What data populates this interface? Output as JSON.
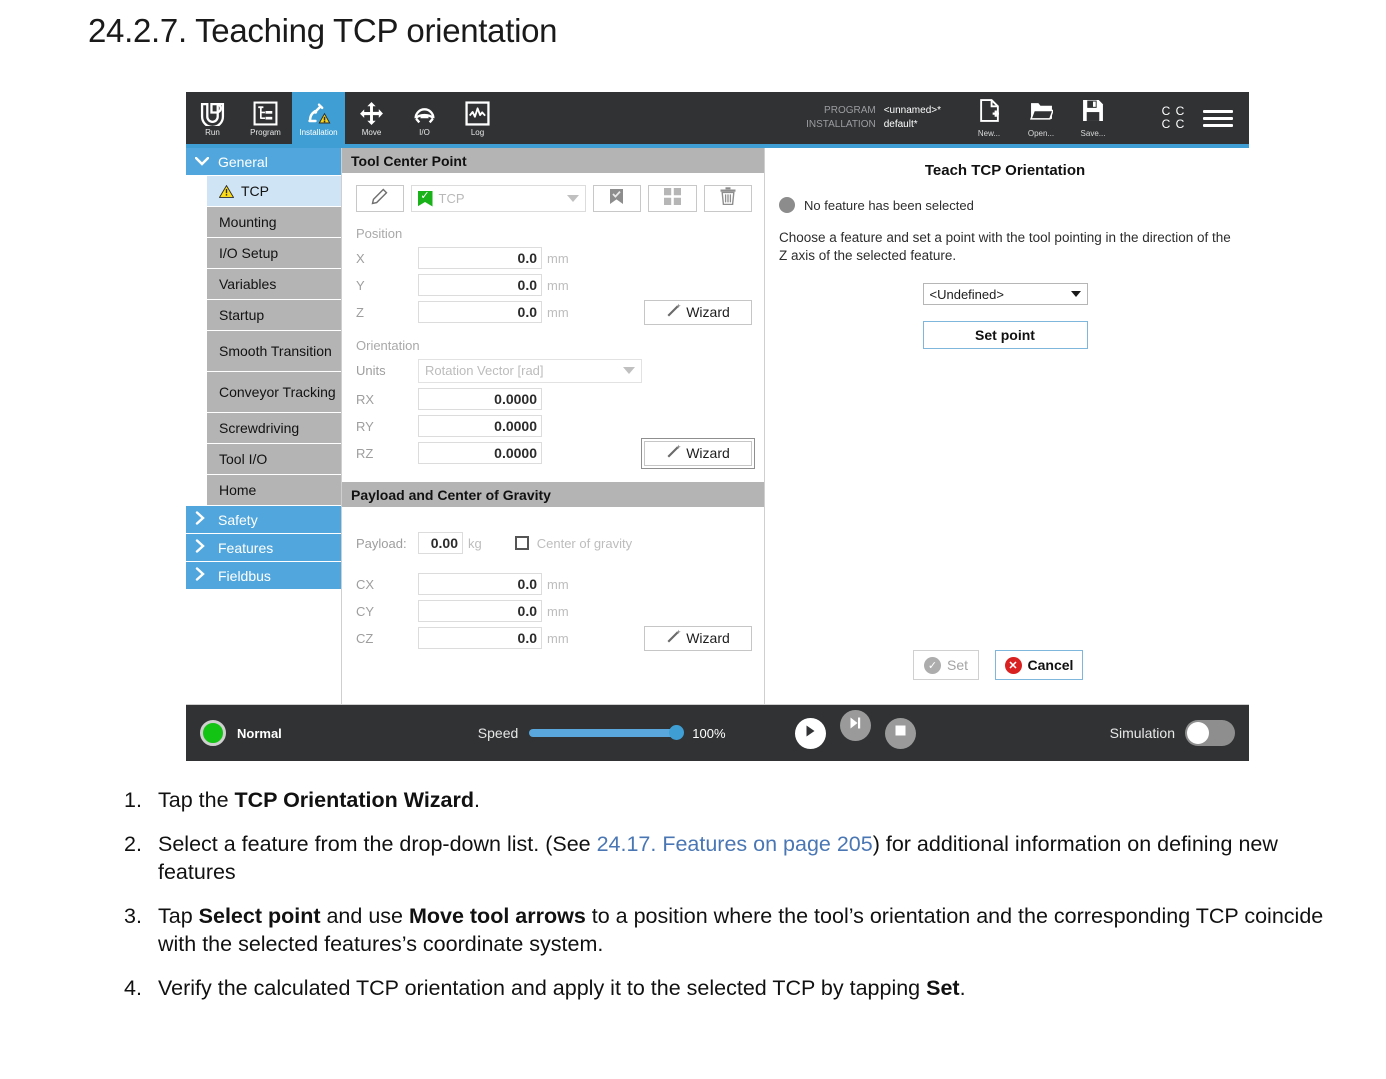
{
  "page": {
    "heading": "24.2.7. Teaching TCP orientation"
  },
  "toolbar": {
    "items": [
      {
        "label": "Run",
        "icon": "ur-logo-icon"
      },
      {
        "label": "Program",
        "icon": "program-tree-icon"
      },
      {
        "label": "Installation",
        "icon": "robot-arm-warning-icon"
      },
      {
        "label": "Move",
        "icon": "move-arrows-icon"
      },
      {
        "label": "I/O",
        "icon": "io-icon"
      },
      {
        "label": "Log",
        "icon": "log-graph-icon"
      }
    ],
    "active_label": "Installation",
    "program_key": "PROGRAM",
    "program_value": "<unnamed>*",
    "installation_key": "INSTALLATION",
    "installation_value": "default*",
    "files": [
      {
        "label": "New...",
        "icon": "new-file-icon"
      },
      {
        "label": "Open...",
        "icon": "open-folder-icon"
      },
      {
        "label": "Save...",
        "icon": "save-floppy-icon"
      }
    ],
    "cc_letters": [
      "C",
      "C",
      "C",
      "C"
    ],
    "menu_icon": "hamburger-menu-icon",
    "accent": "#3f9fd4"
  },
  "sidebar": {
    "groups": [
      {
        "label": "General",
        "expanded": true,
        "items": [
          {
            "label": "TCP",
            "selected": true,
            "warning": true
          },
          {
            "label": "Mounting",
            "selected": false,
            "warning": false
          },
          {
            "label": "I/O Setup",
            "selected": false,
            "warning": false
          },
          {
            "label": "Variables",
            "selected": false,
            "warning": false
          },
          {
            "label": "Startup",
            "selected": false,
            "warning": false
          },
          {
            "label": "Smooth Transition",
            "selected": false,
            "warning": false
          },
          {
            "label": "Conveyor Tracking",
            "selected": false,
            "warning": false
          },
          {
            "label": "Screwdriving",
            "selected": false,
            "warning": false
          },
          {
            "label": "Tool I/O",
            "selected": false,
            "warning": false
          },
          {
            "label": "Home",
            "selected": false,
            "warning": false
          }
        ]
      },
      {
        "label": "Safety",
        "expanded": false,
        "items": []
      },
      {
        "label": "Features",
        "expanded": false,
        "items": []
      },
      {
        "label": "Fieldbus",
        "expanded": false,
        "items": []
      }
    ]
  },
  "tcp_panel": {
    "title": "Tool Center Point",
    "edit_icon": "pencil-icon",
    "tcp_name": "TCP",
    "row_buttons": [
      {
        "icon": "bookmark-check-icon"
      },
      {
        "icon": "add-grid-icon"
      },
      {
        "icon": "trash-icon"
      }
    ],
    "position_label": "Position",
    "position_fields": [
      {
        "name": "X",
        "value": "0.0",
        "unit": "mm"
      },
      {
        "name": "Y",
        "value": "0.0",
        "unit": "mm"
      },
      {
        "name": "Z",
        "value": "0.0",
        "unit": "mm"
      }
    ],
    "position_wizard": "Wizard",
    "orientation_label": "Orientation",
    "units_label": "Units",
    "units_value": "Rotation Vector [rad]",
    "orientation_fields": [
      {
        "name": "RX",
        "value": "0.0000"
      },
      {
        "name": "RY",
        "value": "0.0000"
      },
      {
        "name": "RZ",
        "value": "0.0000"
      }
    ],
    "orientation_wizard": "Wizard"
  },
  "payload_panel": {
    "title": "Payload and Center of Gravity",
    "payload_label": "Payload:",
    "payload_value": "0.00",
    "payload_unit": "kg",
    "cog_checkbox_label": "Center of gravity",
    "cog_fields": [
      {
        "name": "CX",
        "value": "0.0",
        "unit": "mm"
      },
      {
        "name": "CY",
        "value": "0.0",
        "unit": "mm"
      },
      {
        "name": "CZ",
        "value": "0.0",
        "unit": "mm"
      }
    ],
    "cog_wizard": "Wizard"
  },
  "teach_panel": {
    "title": "Teach TCP Orientation",
    "status_text": "No feature has been selected",
    "description": "Choose a feature and set a point with the tool pointing in the direction of the Z axis of the selected feature.",
    "feature_value": "<Undefined>",
    "set_point_label": "Set point",
    "set_label": "Set",
    "cancel_label": "Cancel",
    "set_icon": "check-circle-icon",
    "cancel_icon": "error-circle-icon",
    "cancel_accent": "#d92121"
  },
  "statusbar": {
    "robot_state": "Normal",
    "led_color": "#14c414",
    "speed_label": "Speed",
    "speed_percent": "100%",
    "speed_value": 100,
    "transport": [
      {
        "icon": "play-icon",
        "name": "play-button"
      },
      {
        "icon": "step-icon",
        "name": "step-button"
      },
      {
        "icon": "stop-icon",
        "name": "stop-button"
      }
    ],
    "simulation_label": "Simulation",
    "simulation_on": false
  },
  "steps": [
    {
      "num": "1.",
      "parts": [
        {
          "t": "Tap the ",
          "s": "n"
        },
        {
          "t": "TCP Orientation Wizard",
          "s": "b"
        },
        {
          "t": ".",
          "s": "n"
        }
      ]
    },
    {
      "num": "2.",
      "parts": [
        {
          "t": "Select a feature from the drop-down list. (See ",
          "s": "n"
        },
        {
          "t": "24.17. Features on page 205",
          "s": "x"
        },
        {
          "t": ") for additional information on defining new features",
          "s": "n"
        }
      ]
    },
    {
      "num": "3.",
      "parts": [
        {
          "t": "Tap ",
          "s": "n"
        },
        {
          "t": "Select point",
          "s": "b"
        },
        {
          "t": " and use ",
          "s": "n"
        },
        {
          "t": "Move tool arrows",
          "s": "b"
        },
        {
          "t": " to a position where the tool’s orientation and the corresponding TCP coincide with the selected features’s coordinate system.",
          "s": "n"
        }
      ]
    },
    {
      "num": "4.",
      "parts": [
        {
          "t": "Verify the calculated TCP orientation and apply it to the selected TCP by tapping ",
          "s": "n"
        },
        {
          "t": "Set",
          "s": "b"
        },
        {
          "t": ".",
          "s": "n"
        }
      ]
    }
  ]
}
